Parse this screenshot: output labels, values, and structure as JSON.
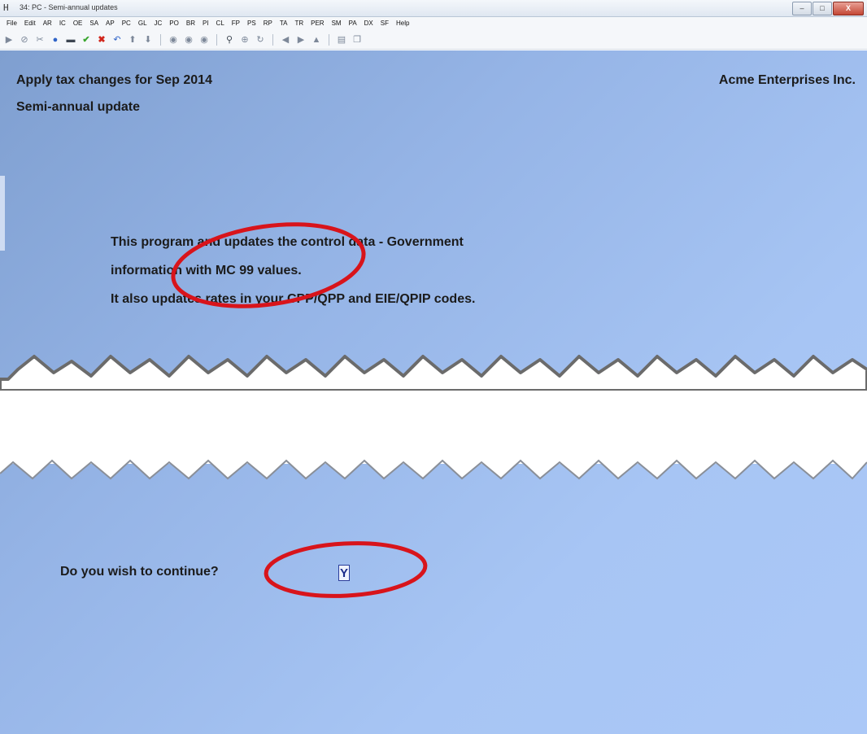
{
  "window": {
    "app_icon": "H",
    "title": "34: PC - Semi-annual updates",
    "controls": [
      "–",
      "□",
      "X"
    ]
  },
  "menu": [
    "File",
    "Edit",
    "AR",
    "IC",
    "OE",
    "SA",
    "AP",
    "PC",
    "GL",
    "JC",
    "PO",
    "BR",
    "PI",
    "CL",
    "FP",
    "PS",
    "RP",
    "TA",
    "TR",
    "PER",
    "SM",
    "PA",
    "DX",
    "SF",
    "Help"
  ],
  "toolbar_icons": [
    {
      "name": "arrow-right-icon",
      "glyph": "▶",
      "cls": ""
    },
    {
      "name": "stop-icon",
      "glyph": "⊘",
      "cls": ""
    },
    {
      "name": "tools-icon",
      "glyph": "✂",
      "cls": ""
    },
    {
      "name": "globe-icon",
      "glyph": "●",
      "cls": "blue"
    },
    {
      "name": "printer-icon",
      "glyph": "▬",
      "cls": "dark"
    },
    {
      "name": "check-icon",
      "glyph": "✔",
      "cls": "green"
    },
    {
      "name": "cancel-icon",
      "glyph": "✖",
      "cls": "red"
    },
    {
      "name": "undo-icon",
      "glyph": "↶",
      "cls": "blue"
    },
    {
      "name": "arrow-up-icon",
      "glyph": "⬆",
      "cls": ""
    },
    {
      "name": "arrow-down-icon",
      "glyph": "⬇",
      "cls": ""
    },
    {
      "name": "separator",
      "glyph": "",
      "cls": "sep"
    },
    {
      "name": "circle-1-icon",
      "glyph": "◉",
      "cls": ""
    },
    {
      "name": "circle-2-icon",
      "glyph": "◉",
      "cls": ""
    },
    {
      "name": "circle-3-icon",
      "glyph": "◉",
      "cls": ""
    },
    {
      "name": "separator",
      "glyph": "",
      "cls": "sep"
    },
    {
      "name": "binoculars-icon",
      "glyph": "⚲",
      "cls": "dark"
    },
    {
      "name": "zoom-icon",
      "glyph": "⊕",
      "cls": ""
    },
    {
      "name": "refresh-icon",
      "glyph": "↻",
      "cls": ""
    },
    {
      "name": "separator",
      "glyph": "",
      "cls": "sep"
    },
    {
      "name": "previous-icon",
      "glyph": "◀",
      "cls": ""
    },
    {
      "name": "next-icon",
      "glyph": "▶",
      "cls": ""
    },
    {
      "name": "stamp-icon",
      "glyph": "▲",
      "cls": ""
    },
    {
      "name": "separator",
      "glyph": "",
      "cls": "sep"
    },
    {
      "name": "document-icon",
      "glyph": "▤",
      "cls": ""
    },
    {
      "name": "copy-icon",
      "glyph": "❐",
      "cls": ""
    }
  ],
  "screen": {
    "heading": "Apply tax changes for Sep 2014",
    "company": "Acme Enterprises Inc.",
    "subheading": "Semi-annual update",
    "body": {
      "line1": "This program and updates the control data - Government",
      "line2": "information with MC 99 values.",
      "line3": "It also updates rates in your CPP/QPP and EIE/QPIP codes."
    },
    "prompt": "Do you wish to continue?",
    "answer": "Y"
  },
  "colors": {
    "callout": "#d8141b",
    "panel": "#9ab9ec"
  }
}
